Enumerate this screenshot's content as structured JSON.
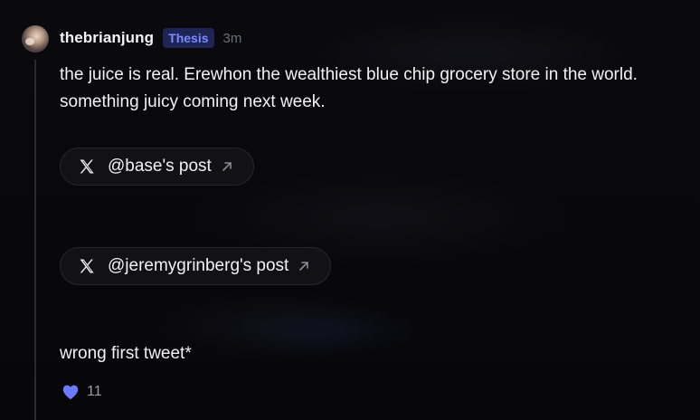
{
  "post": {
    "username": "thebrianjung",
    "badge": "Thesis",
    "timestamp": "3m",
    "text": "the juice is real. Erewhon the wealthiest blue chip grocery store in the world. something juicy coming next week.",
    "links": [
      {
        "label": "@base's post",
        "icon": "x-logo-icon"
      },
      {
        "label": "@jeremygrinberg's post",
        "icon": "x-logo-icon"
      }
    ],
    "followup_text": "wrong first tweet*",
    "likes": {
      "count": "11",
      "icon": "heart-icon"
    }
  },
  "colors": {
    "background": "#08080b",
    "badge_text": "#7c8cff",
    "badge_bg": "#1e2454",
    "heart": "#6b7bff"
  }
}
